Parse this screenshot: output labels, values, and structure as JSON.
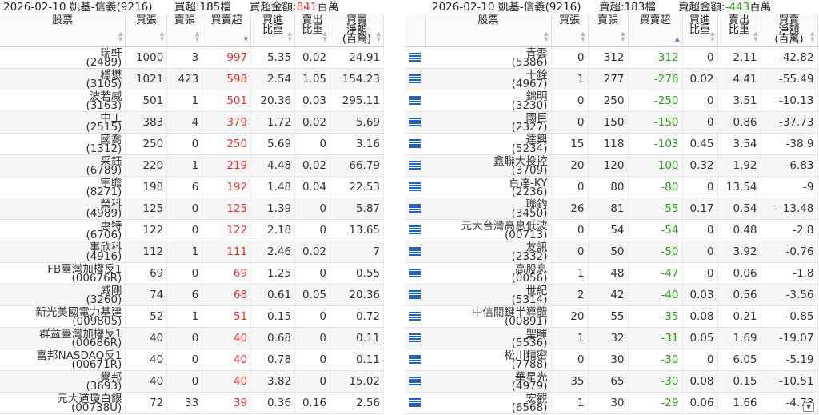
{
  "left": {
    "title": {
      "date_broker": "2026-02-10 凱基-信義(9216)",
      "count_label": "買超:185檔",
      "amount_label": "買超金額:",
      "amount_value": "841",
      "amount_unit": "百萬"
    },
    "headers": {
      "stock": "股票",
      "buy": "買張",
      "sell": "賣張",
      "net": "買賣超",
      "buy_ratio": [
        "買進",
        "比重"
      ],
      "sell_ratio": [
        "賣出",
        "比重"
      ],
      "net_amount": [
        "買賣",
        "淨額",
        "(百萬)"
      ]
    },
    "rows": [
      {
        "name": "瑞軒",
        "code": "(2489)",
        "buy": "1000",
        "sell": "3",
        "net": "997",
        "buy_ratio": "5.35",
        "sell_ratio": "0.02",
        "amount": "24.91"
      },
      {
        "name": "穩懋",
        "code": "(3105)",
        "buy": "1021",
        "sell": "423",
        "net": "598",
        "buy_ratio": "2.54",
        "sell_ratio": "1.05",
        "amount": "154.23"
      },
      {
        "name": "波若威",
        "code": "(3163)",
        "buy": "501",
        "sell": "1",
        "net": "501",
        "buy_ratio": "20.36",
        "sell_ratio": "0.03",
        "amount": "295.11"
      },
      {
        "name": "中工",
        "code": "(2515)",
        "buy": "383",
        "sell": "4",
        "net": "379",
        "buy_ratio": "1.72",
        "sell_ratio": "0.02",
        "amount": "5.69"
      },
      {
        "name": "國喬",
        "code": "(1312)",
        "buy": "250",
        "sell": "0",
        "net": "250",
        "buy_ratio": "5.69",
        "sell_ratio": "0",
        "amount": "3.16"
      },
      {
        "name": "采鈺",
        "code": "(6789)",
        "buy": "220",
        "sell": "1",
        "net": "219",
        "buy_ratio": "4.48",
        "sell_ratio": "0.02",
        "amount": "66.79"
      },
      {
        "name": "宇瞻",
        "code": "(8271)",
        "buy": "198",
        "sell": "6",
        "net": "192",
        "buy_ratio": "1.48",
        "sell_ratio": "0.04",
        "amount": "22.53"
      },
      {
        "name": "榮科",
        "code": "(4989)",
        "buy": "125",
        "sell": "0",
        "net": "125",
        "buy_ratio": "1.39",
        "sell_ratio": "0",
        "amount": "5.87"
      },
      {
        "name": "惠特",
        "code": "(6706)",
        "buy": "122",
        "sell": "0",
        "net": "122",
        "buy_ratio": "2.18",
        "sell_ratio": "0",
        "amount": "13.65"
      },
      {
        "name": "事欣科",
        "code": "(4916)",
        "buy": "112",
        "sell": "1",
        "net": "111",
        "buy_ratio": "2.46",
        "sell_ratio": "0.02",
        "amount": "7"
      },
      {
        "name": "FB臺灣加權反1",
        "code": "(00676R)",
        "buy": "69",
        "sell": "0",
        "net": "69",
        "buy_ratio": "1.25",
        "sell_ratio": "0",
        "amount": "0.55"
      },
      {
        "name": "威剛",
        "code": "(3260)",
        "buy": "74",
        "sell": "6",
        "net": "68",
        "buy_ratio": "0.61",
        "sell_ratio": "0.05",
        "amount": "20.36"
      },
      {
        "name": "新光美國電力基建",
        "code": "(009805)",
        "buy": "52",
        "sell": "1",
        "net": "51",
        "buy_ratio": "0.15",
        "sell_ratio": "0",
        "amount": "0.72"
      },
      {
        "name": "群益臺灣加權反1",
        "code": "(00686R)",
        "buy": "40",
        "sell": "0",
        "net": "40",
        "buy_ratio": "0.68",
        "sell_ratio": "0",
        "amount": "0.11"
      },
      {
        "name": "富邦NASDAQ反1",
        "code": "(00671R)",
        "buy": "40",
        "sell": "0",
        "net": "40",
        "buy_ratio": "0.78",
        "sell_ratio": "0",
        "amount": "0.11"
      },
      {
        "name": "譽邦",
        "code": "(3693)",
        "buy": "40",
        "sell": "0",
        "net": "40",
        "buy_ratio": "3.82",
        "sell_ratio": "0",
        "amount": "15.02"
      },
      {
        "name": "元大道瓊白銀",
        "code": "(00738U)",
        "buy": "72",
        "sell": "33",
        "net": "39",
        "buy_ratio": "0.36",
        "sell_ratio": "0.16",
        "amount": "2.56"
      }
    ]
  },
  "right": {
    "title": {
      "date_broker": "2026-02-10 凱基-信義(9216)",
      "count_label": "賣超:183檔",
      "amount_label": "賣超金額:",
      "amount_value": "-443",
      "amount_unit": "百萬"
    },
    "headers": {
      "stock": "股票",
      "buy": "買張",
      "sell": "賣張",
      "net": "買賣超",
      "buy_ratio": [
        "買進",
        "比重"
      ],
      "sell_ratio": [
        "賣出",
        "比重"
      ],
      "net_amount": [
        "買賣",
        "淨額",
        "(百萬)"
      ]
    },
    "rows": [
      {
        "name": "青雲",
        "code": "(5386)",
        "buy": "0",
        "sell": "312",
        "net": "-312",
        "buy_ratio": "0",
        "sell_ratio": "2.11",
        "amount": "-42.82"
      },
      {
        "name": "十銓",
        "code": "(4967)",
        "buy": "1",
        "sell": "277",
        "net": "-276",
        "buy_ratio": "0.02",
        "sell_ratio": "4.41",
        "amount": "-55.49"
      },
      {
        "name": "錦明",
        "code": "(3230)",
        "buy": "0",
        "sell": "250",
        "net": "-250",
        "buy_ratio": "0",
        "sell_ratio": "3.51",
        "amount": "-10.13"
      },
      {
        "name": "國巨",
        "code": "(2327)",
        "buy": "0",
        "sell": "150",
        "net": "-150",
        "buy_ratio": "0",
        "sell_ratio": "0.86",
        "amount": "-37.73"
      },
      {
        "name": "達興",
        "code": "(5234)",
        "buy": "15",
        "sell": "118",
        "net": "-103",
        "buy_ratio": "0.45",
        "sell_ratio": "3.54",
        "amount": "-38.9"
      },
      {
        "name": "鑫聯大投控",
        "code": "(3709)",
        "buy": "20",
        "sell": "120",
        "net": "-100",
        "buy_ratio": "0.32",
        "sell_ratio": "1.92",
        "amount": "-6.83"
      },
      {
        "name": "百達-KY",
        "code": "(2236)",
        "buy": "0",
        "sell": "80",
        "net": "-80",
        "buy_ratio": "0",
        "sell_ratio": "13.54",
        "amount": "-9"
      },
      {
        "name": "聯鈞",
        "code": "(3450)",
        "buy": "26",
        "sell": "81",
        "net": "-55",
        "buy_ratio": "0.17",
        "sell_ratio": "0.54",
        "amount": "-13.48"
      },
      {
        "name": "元大台灣高息低波",
        "code": "(00713)",
        "buy": "0",
        "sell": "54",
        "net": "-54",
        "buy_ratio": "0",
        "sell_ratio": "0.48",
        "amount": "-2.8"
      },
      {
        "name": "友訊",
        "code": "(2332)",
        "buy": "0",
        "sell": "50",
        "net": "-50",
        "buy_ratio": "0",
        "sell_ratio": "3.92",
        "amount": "-0.76"
      },
      {
        "name": "高股息",
        "code": "(0056)",
        "buy": "1",
        "sell": "48",
        "net": "-47",
        "buy_ratio": "0",
        "sell_ratio": "0.06",
        "amount": "-1.8"
      },
      {
        "name": "世紀",
        "code": "(5314)",
        "buy": "2",
        "sell": "42",
        "net": "-40",
        "buy_ratio": "0.03",
        "sell_ratio": "0.56",
        "amount": "-3.56"
      },
      {
        "name": "中信關鍵半導體",
        "code": "(00891)",
        "buy": "20",
        "sell": "55",
        "net": "-35",
        "buy_ratio": "0.08",
        "sell_ratio": "0.21",
        "amount": "-0.85"
      },
      {
        "name": "聖暉",
        "code": "(5536)",
        "buy": "1",
        "sell": "32",
        "net": "-31",
        "buy_ratio": "0.05",
        "sell_ratio": "1.69",
        "amount": "-19.07"
      },
      {
        "name": "松川精密",
        "code": "(7788)",
        "buy": "0",
        "sell": "30",
        "net": "-30",
        "buy_ratio": "0",
        "sell_ratio": "6.05",
        "amount": "-5.19"
      },
      {
        "name": "華星光",
        "code": "(4979)",
        "buy": "35",
        "sell": "65",
        "net": "-30",
        "buy_ratio": "0.08",
        "sell_ratio": "0.15",
        "amount": "-10.51"
      },
      {
        "name": "宏觀",
        "code": "(6568)",
        "buy": "1",
        "sell": "30",
        "net": "-29",
        "buy_ratio": "0.06",
        "sell_ratio": "1.66",
        "amount": "-4.73"
      }
    ]
  },
  "colors": {
    "positive": "#e8312c",
    "negative": "#2c9c1d",
    "icon": "#1c64c8"
  },
  "icons": {
    "row_detail": "list-icon",
    "scroll": "chevron-down-icon"
  }
}
